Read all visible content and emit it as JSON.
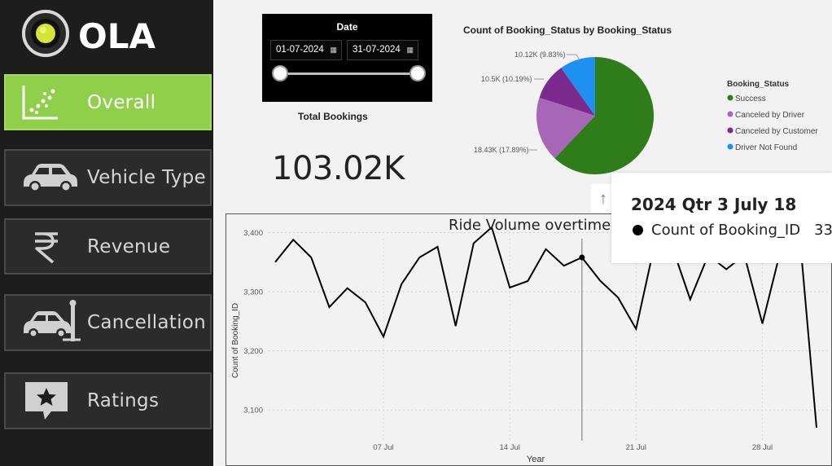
{
  "brand": {
    "logo_text": "OLA"
  },
  "nav": {
    "items": [
      {
        "label": "Overall",
        "icon": "scatter-chart-icon",
        "active": true
      },
      {
        "label": "Vehicle Type",
        "icon": "car-icon",
        "active": false
      },
      {
        "label": "Revenue",
        "icon": "rupee-icon",
        "active": false
      },
      {
        "label": "Cancellation",
        "icon": "car-crash-icon",
        "active": false
      },
      {
        "label": "Ratings",
        "icon": "star-bubble-icon",
        "active": false
      }
    ]
  },
  "date_slicer": {
    "title": "Date",
    "start": "01-07-2024",
    "end": "31-07-2024"
  },
  "kpi": {
    "label": "Total Bookings",
    "value": "103.02K"
  },
  "colors": {
    "accent": "#8fcf4a",
    "success": "#2e7d1a",
    "canceled_by_driver": "#a866b8",
    "canceled_by_customer": "#7b2a8e",
    "driver_not_found": "#1e90f0"
  },
  "pie": {
    "title": "Count of Booking_Status by Booking_Status",
    "legend_title": "Booking_Status",
    "legend": [
      "Success",
      "Canceled by Driver",
      "Canceled by Customer",
      "Driver Not Found"
    ],
    "labels": [
      "10.12K (9.83%)",
      "10.5K (10.19%)",
      "18.43K (17.89%)"
    ]
  },
  "line_chart": {
    "title": "Ride Volume overtime",
    "xlabel": "Year",
    "ylabel": "Count of Booking_ID",
    "y_ticks": [
      "3,400",
      "3,300",
      "3,200",
      "3,100"
    ],
    "x_ticks": [
      "07 Jul",
      "14 Jul",
      "21 Jul",
      "28 Jul"
    ]
  },
  "tooltip": {
    "title": "2024 Qtr 3 July 18",
    "label": "Count of Booking_ID",
    "value": "33"
  },
  "chart_data": [
    {
      "type": "pie",
      "title": "Count of Booking_Status by Booking_Status",
      "categories": [
        "Success",
        "Canceled by Driver",
        "Canceled by Customer",
        "Driver Not Found"
      ],
      "values": [
        63970,
        18430,
        10500,
        10120
      ],
      "percent": [
        62.09,
        17.89,
        10.19,
        9.83
      ],
      "legend_placement": "right"
    },
    {
      "type": "line",
      "title": "Ride Volume overtime",
      "xlabel": "Year",
      "ylabel": "Count of Booking_ID",
      "x": [
        "2024-07-01",
        "2024-07-02",
        "2024-07-03",
        "2024-07-04",
        "2024-07-05",
        "2024-07-06",
        "2024-07-07",
        "2024-07-08",
        "2024-07-09",
        "2024-07-10",
        "2024-07-11",
        "2024-07-12",
        "2024-07-13",
        "2024-07-14",
        "2024-07-15",
        "2024-07-16",
        "2024-07-17",
        "2024-07-18",
        "2024-07-19",
        "2024-07-20",
        "2024-07-21",
        "2024-07-22",
        "2024-07-23",
        "2024-07-24",
        "2024-07-25",
        "2024-07-26",
        "2024-07-27",
        "2024-07-28",
        "2024-07-29",
        "2024-07-30",
        "2024-07-31"
      ],
      "series": [
        {
          "values": [
            3350,
            3388,
            3358,
            3274,
            3306,
            3282,
            3224,
            3313,
            3358,
            3376,
            3242,
            3382,
            3409,
            3307,
            3318,
            3372,
            3344,
            3358,
            3319,
            3290,
            3237,
            3376,
            3376,
            3287,
            3362,
            3338,
            3362,
            3246,
            3369,
            3419,
            3070
          ]
        }
      ],
      "ylim": [
        3070,
        3420
      ],
      "grid": true,
      "highlight": {
        "x": "2024-07-18",
        "y": 3358
      }
    }
  ]
}
